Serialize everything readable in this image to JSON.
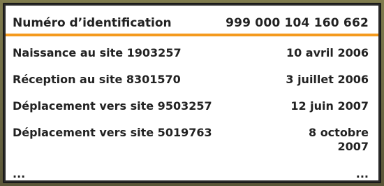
{
  "header": {
    "label": "Numéro d’identification",
    "value": "999 000 104 160 662"
  },
  "colors": {
    "accent": "#f49a1e",
    "text": "#222222",
    "background": "#ffffff",
    "frame": "#2a2a2a"
  },
  "rows": [
    {
      "label": "Naissance au site 1903257",
      "date": "10 avril 2006"
    },
    {
      "label": "Réception au site 8301570",
      "date": "3 juillet 2006"
    },
    {
      "label": "Déplacement vers site 9503257",
      "date": "12 juin 2007"
    },
    {
      "label": "Déplacement vers site 5019763",
      "date": "8 octobre 2007"
    },
    {
      "label": "...",
      "date": "..."
    }
  ]
}
